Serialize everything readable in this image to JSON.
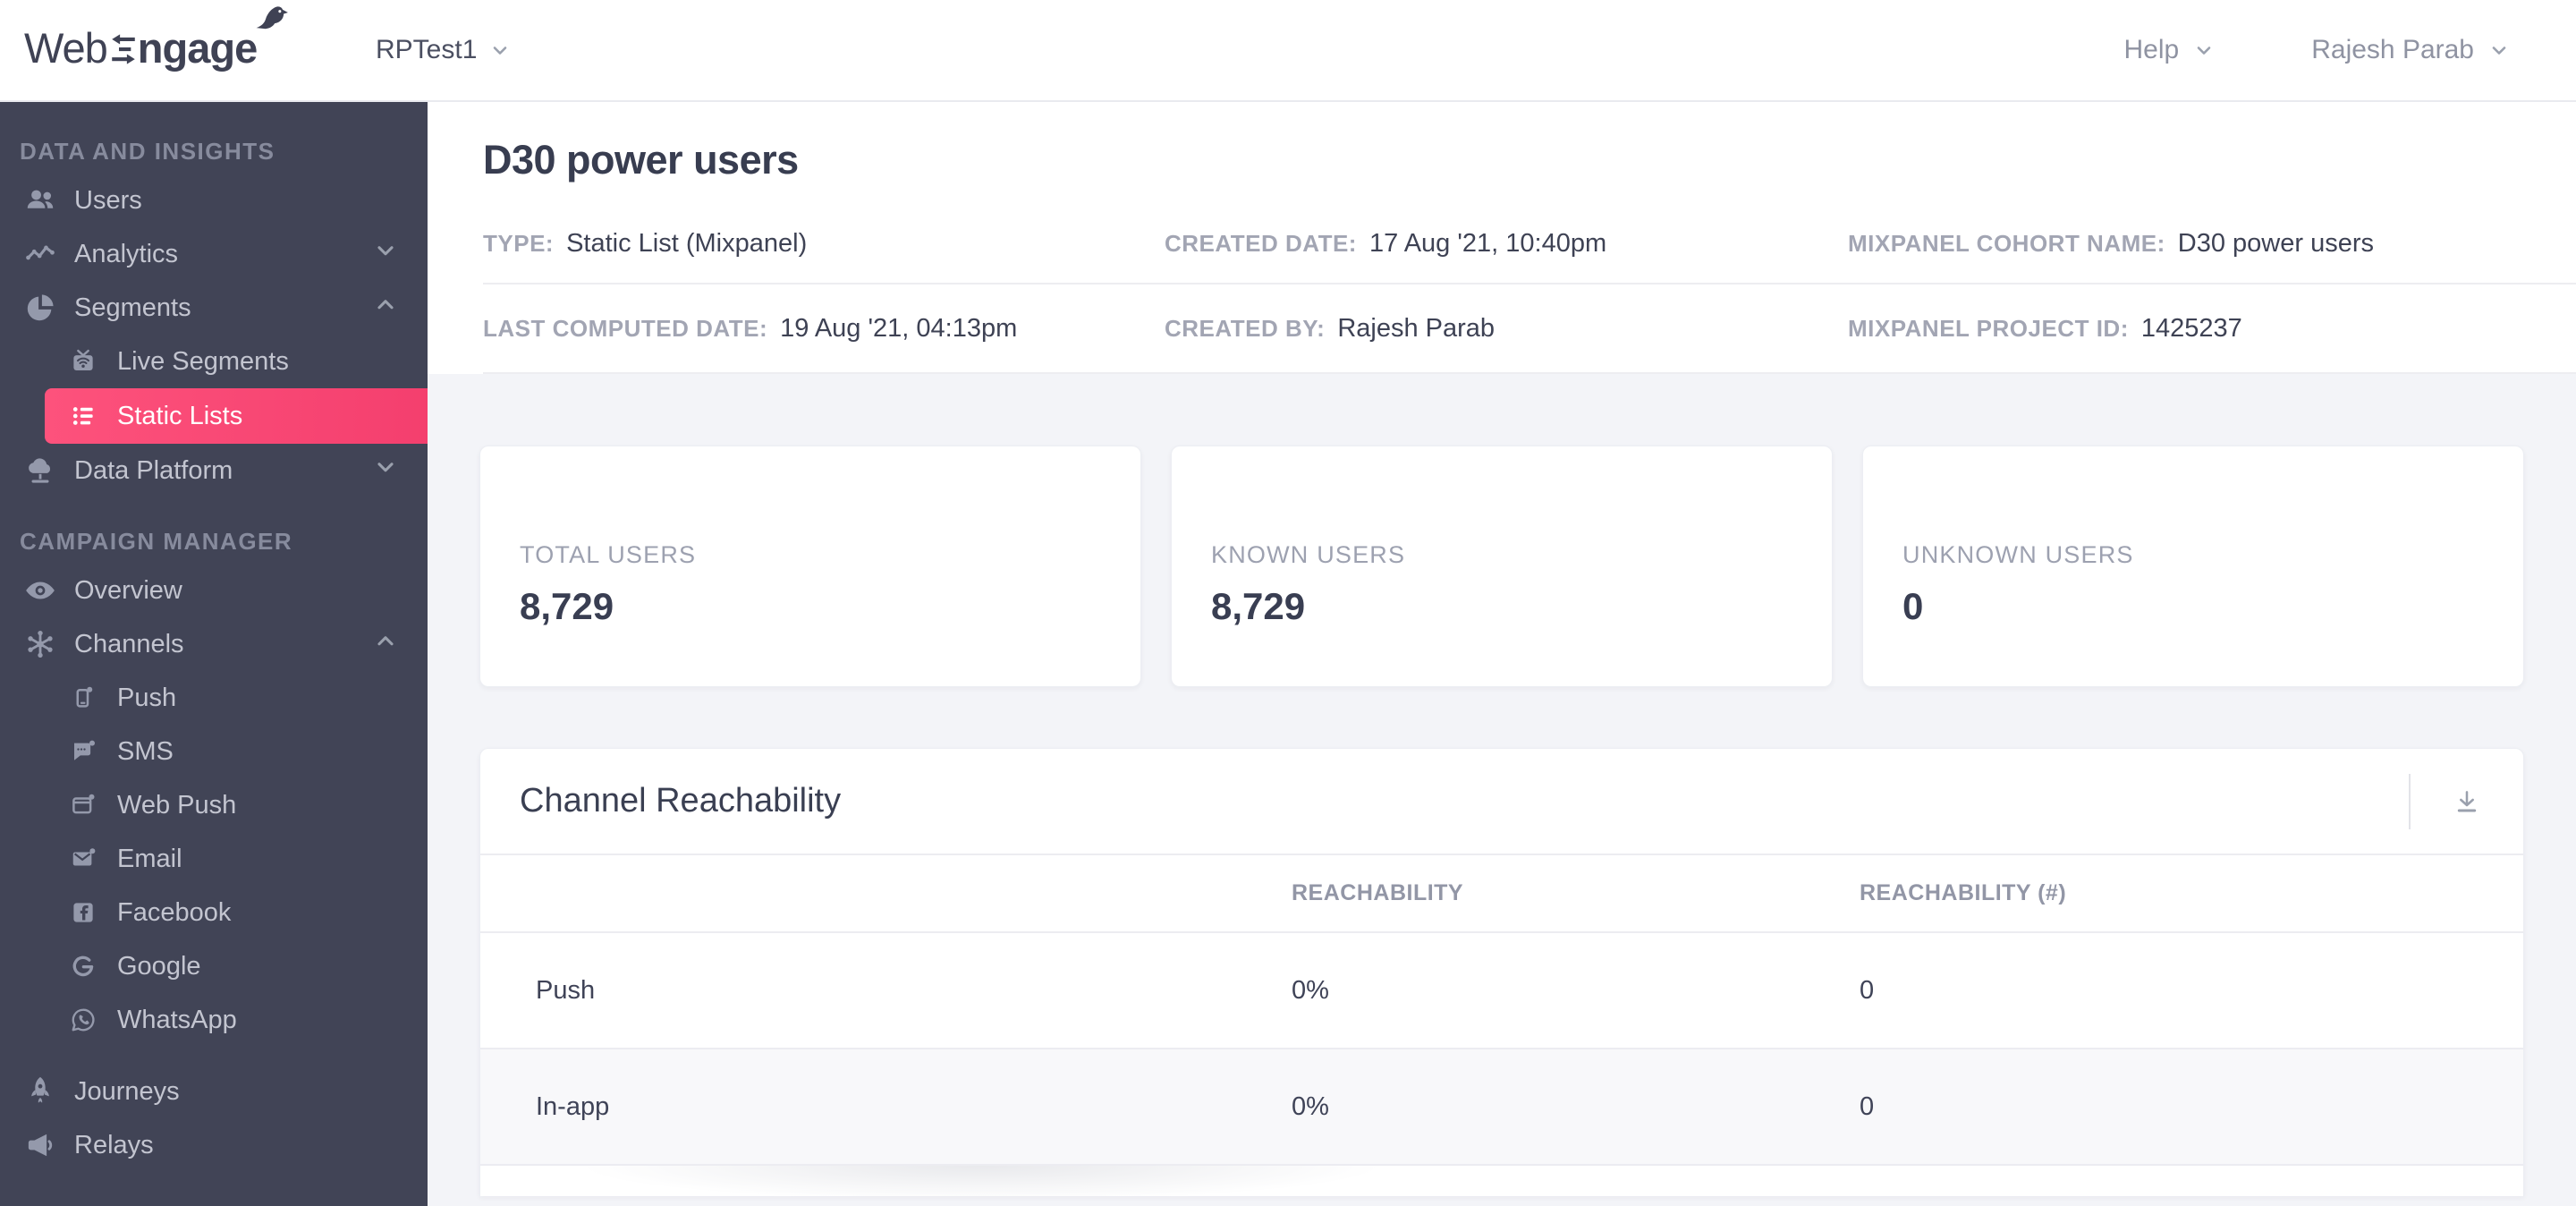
{
  "brand": {
    "web": "Web",
    "ngage": "ngage",
    "logo_alt": "WebEngage"
  },
  "topbar": {
    "project": "RPTest1",
    "help": "Help",
    "user": "Rajesh Parab"
  },
  "colors": {
    "accent": "#f43f6e",
    "sidebar_bg": "#414456",
    "content_bg": "#f3f4f8"
  },
  "sidebar": {
    "sections": [
      {
        "title": "DATA AND INSIGHTS",
        "items": [
          {
            "label": "Users",
            "icon": "users-icon"
          },
          {
            "label": "Analytics",
            "icon": "analytics-icon",
            "chevron": "down"
          },
          {
            "label": "Segments",
            "icon": "segments-icon",
            "chevron": "up"
          },
          {
            "label": "Live Segments",
            "icon": "live-segments-icon",
            "sub": true
          },
          {
            "label": "Static Lists",
            "icon": "static-lists-icon",
            "sub": true,
            "active": true
          },
          {
            "label": "Data Platform",
            "icon": "data-platform-icon",
            "chevron": "down"
          }
        ]
      },
      {
        "title": "CAMPAIGN MANAGER",
        "items": [
          {
            "label": "Overview",
            "icon": "overview-icon"
          },
          {
            "label": "Channels",
            "icon": "channels-icon",
            "chevron": "up"
          },
          {
            "label": "Push",
            "icon": "push-icon",
            "sub": true
          },
          {
            "label": "SMS",
            "icon": "sms-icon",
            "sub": true
          },
          {
            "label": "Web Push",
            "icon": "web-push-icon",
            "sub": true
          },
          {
            "label": "Email",
            "icon": "email-icon",
            "sub": true
          },
          {
            "label": "Facebook",
            "icon": "facebook-icon",
            "sub": true
          },
          {
            "label": "Google",
            "icon": "google-icon",
            "sub": true
          },
          {
            "label": "WhatsApp",
            "icon": "whatsapp-icon",
            "sub": true
          },
          {
            "label": "Journeys",
            "icon": "journeys-icon",
            "gap": true
          },
          {
            "label": "Relays",
            "icon": "relays-icon"
          }
        ]
      }
    ]
  },
  "page": {
    "title": "D30 power users",
    "meta_rows": [
      [
        {
          "label": "TYPE:",
          "value": "Static List (Mixpanel)"
        },
        {
          "label": "CREATED DATE:",
          "value": "17 Aug '21, 10:40pm"
        },
        {
          "label": "MIXPANEL COHORT NAME:",
          "value": "D30 power users"
        }
      ],
      [
        {
          "label": "LAST COMPUTED DATE:",
          "value": "19 Aug '21, 04:13pm"
        },
        {
          "label": "CREATED BY:",
          "value": "Rajesh Parab"
        },
        {
          "label": "MIXPANEL PROJECT ID:",
          "value": "1425237"
        }
      ]
    ]
  },
  "stats": [
    {
      "label": "TOTAL USERS",
      "value": "8,729"
    },
    {
      "label": "KNOWN USERS",
      "value": "8,729"
    },
    {
      "label": "UNKNOWN USERS",
      "value": "0"
    }
  ],
  "reachability": {
    "title": "Channel Reachability",
    "columns": [
      "REACHABILITY",
      "REACHABILITY (#)"
    ],
    "rows": [
      {
        "channel": "Push",
        "reachability": "0%",
        "count": "0"
      },
      {
        "channel": "In-app",
        "reachability": "0%",
        "count": "0"
      }
    ]
  }
}
